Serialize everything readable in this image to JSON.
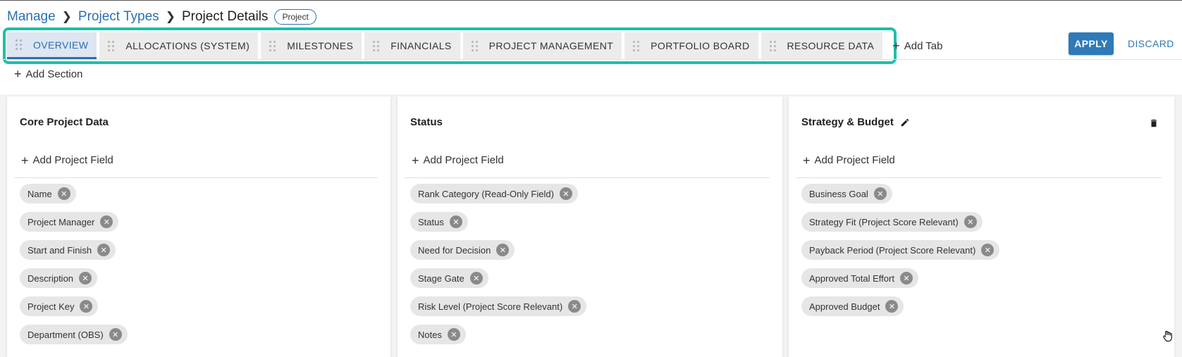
{
  "breadcrumb": {
    "items": [
      "Manage",
      "Project Types"
    ],
    "current": "Project Details",
    "badge": "Project"
  },
  "tabs": [
    {
      "label": "OVERVIEW",
      "active": true
    },
    {
      "label": "ALLOCATIONS (SYSTEM)"
    },
    {
      "label": "MILESTONES"
    },
    {
      "label": "FINANCIALS"
    },
    {
      "label": "PROJECT MANAGEMENT"
    },
    {
      "label": "PORTFOLIO BOARD"
    },
    {
      "label": "RESOURCE DATA"
    }
  ],
  "add_tab_label": "Add Tab",
  "actions": {
    "apply": "APPLY",
    "discard": "DISCARD"
  },
  "add_section_label": "Add Section",
  "add_field_label": "Add Project Field",
  "colors": {
    "accent": "#2f7ab9",
    "highlight": "#1ebfaa"
  },
  "icons": {
    "tab_grip": "drag-handle-icon",
    "add": "plus-icon",
    "remove_chip": "close-circle-icon",
    "edit": "pencil-icon",
    "delete": "trash-icon",
    "cursor": "hand-cursor-icon"
  },
  "sections": [
    {
      "title": "Core Project Data",
      "fields": [
        "Name",
        "Project Manager",
        "Start and Finish",
        "Description",
        "Project Key",
        "Department (OBS)"
      ]
    },
    {
      "title": "Status",
      "fields": [
        "Rank Category (Read-Only Field)",
        "Status",
        "Need for Decision",
        "Stage Gate",
        "Risk Level (Project Score Relevant)",
        "Notes"
      ]
    },
    {
      "title": "Strategy & Budget",
      "fields": [
        "Business Goal",
        "Strategy Fit (Project Score Relevant)",
        "Payback Period (Project Score Relevant)",
        "Approved Total Effort",
        "Approved Budget"
      ]
    }
  ]
}
